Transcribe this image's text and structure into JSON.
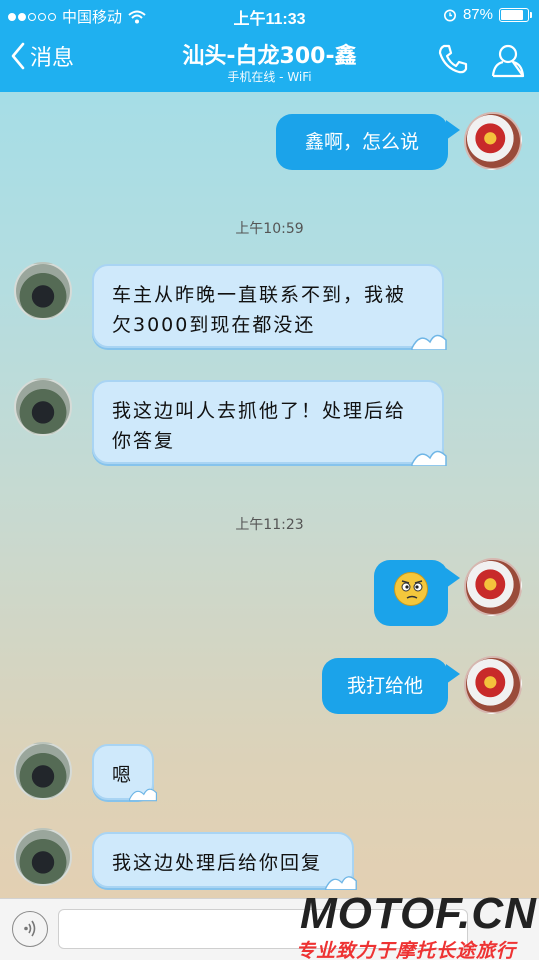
{
  "status_bar": {
    "carrier": "中国移动",
    "time": "上午11:33",
    "battery": "87%",
    "battery_level": 0.87
  },
  "nav": {
    "back_label": "消息",
    "title": "汕头-白龙300-鑫",
    "subtitle": "手机在线 - WiFi"
  },
  "messages": {
    "m1": "鑫啊，怎么说",
    "ts1": "上午10:59",
    "m2": "车主从昨晚一直联系不到，我被欠3000到现在都没还",
    "m3": "我这边叫人去抓他了！处理后给你答复",
    "ts2": "上午11:23",
    "m5": "我打给他",
    "m6": "嗯",
    "m7": "我这边处理后给你回复"
  },
  "watermark": {
    "logo": "MOTOF.CN",
    "tagline": "专业致力于摩托长途旅行"
  },
  "colors": {
    "nav_bg": "#1fb0f0",
    "outgoing_bubble": "#1ba3ea",
    "incoming_bubble": "#cfe9fb"
  }
}
